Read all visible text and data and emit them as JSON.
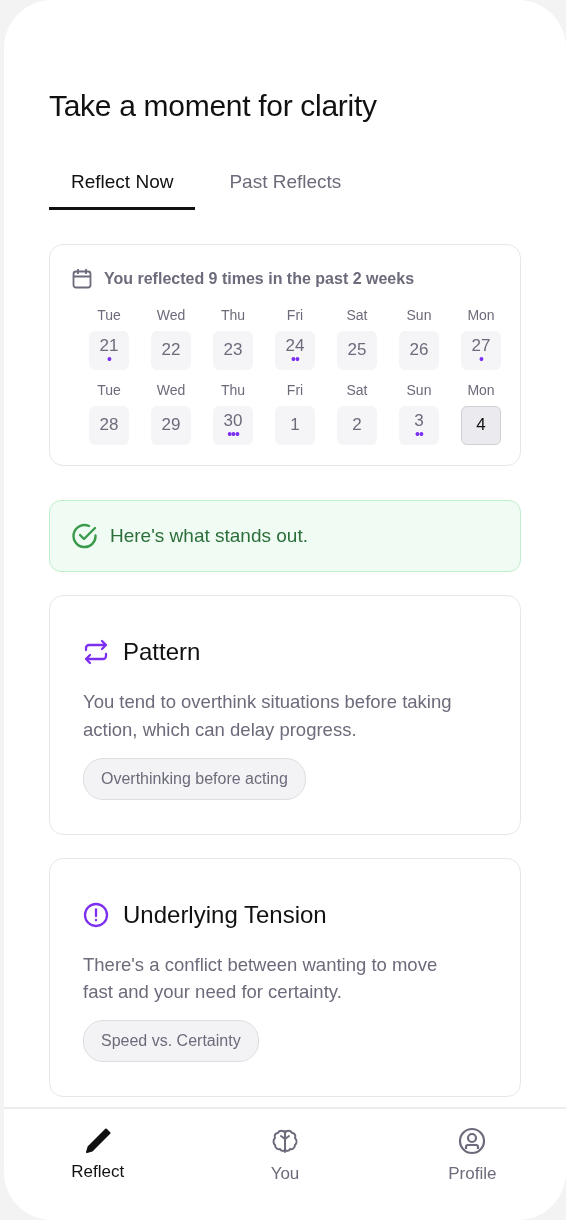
{
  "title": "Take a moment for clarity",
  "tabs": [
    {
      "label": "Reflect Now",
      "selected": true
    },
    {
      "label": "Past Reflects",
      "selected": false
    }
  ],
  "summary": {
    "text": "You reflected 9 times in the past 2 weeks"
  },
  "days": [
    {
      "weekday": "Tue",
      "date": "21",
      "dots": "•",
      "selected": false
    },
    {
      "weekday": "Wed",
      "date": "22",
      "selected": false
    },
    {
      "weekday": "Thu",
      "date": "23",
      "selected": false
    },
    {
      "weekday": "Fri",
      "date": "24",
      "dots": "••",
      "selected": false
    },
    {
      "weekday": "Sat",
      "date": "25",
      "selected": false
    },
    {
      "weekday": "Sun",
      "date": "26",
      "selected": false
    },
    {
      "weekday": "Mon",
      "date": "27",
      "dots": "•",
      "selected": false
    },
    {
      "weekday": "Tue",
      "date": "28",
      "selected": false
    },
    {
      "weekday": "Wed",
      "date": "29",
      "selected": false
    },
    {
      "weekday": "Thu",
      "date": "30",
      "dots": "•••",
      "selected": false
    },
    {
      "weekday": "Fri",
      "date": "1",
      "selected": false
    },
    {
      "weekday": "Sat",
      "date": "2",
      "selected": false
    },
    {
      "weekday": "Sun",
      "date": "3",
      "dots": "••",
      "selected": false
    },
    {
      "weekday": "Mon",
      "date": "4",
      "selected": true
    }
  ],
  "notice": {
    "text": "Here's what stands out."
  },
  "insights": [
    {
      "kind": "pattern",
      "title": "Pattern",
      "body": "You tend to overthink situations before taking action, which can delay progress.",
      "tag": "Overthinking before acting"
    },
    {
      "kind": "tension",
      "title": "Underlying Tension",
      "body": "There's a conflict between wanting to move fast and your need for certainty.",
      "tag": "Speed vs. Certainty"
    }
  ],
  "nav": [
    {
      "kind": "pen",
      "label": "Reflect",
      "selected": true
    },
    {
      "kind": "brain",
      "label": "You",
      "selected": false
    },
    {
      "kind": "person",
      "label": "Profile",
      "selected": false
    }
  ]
}
